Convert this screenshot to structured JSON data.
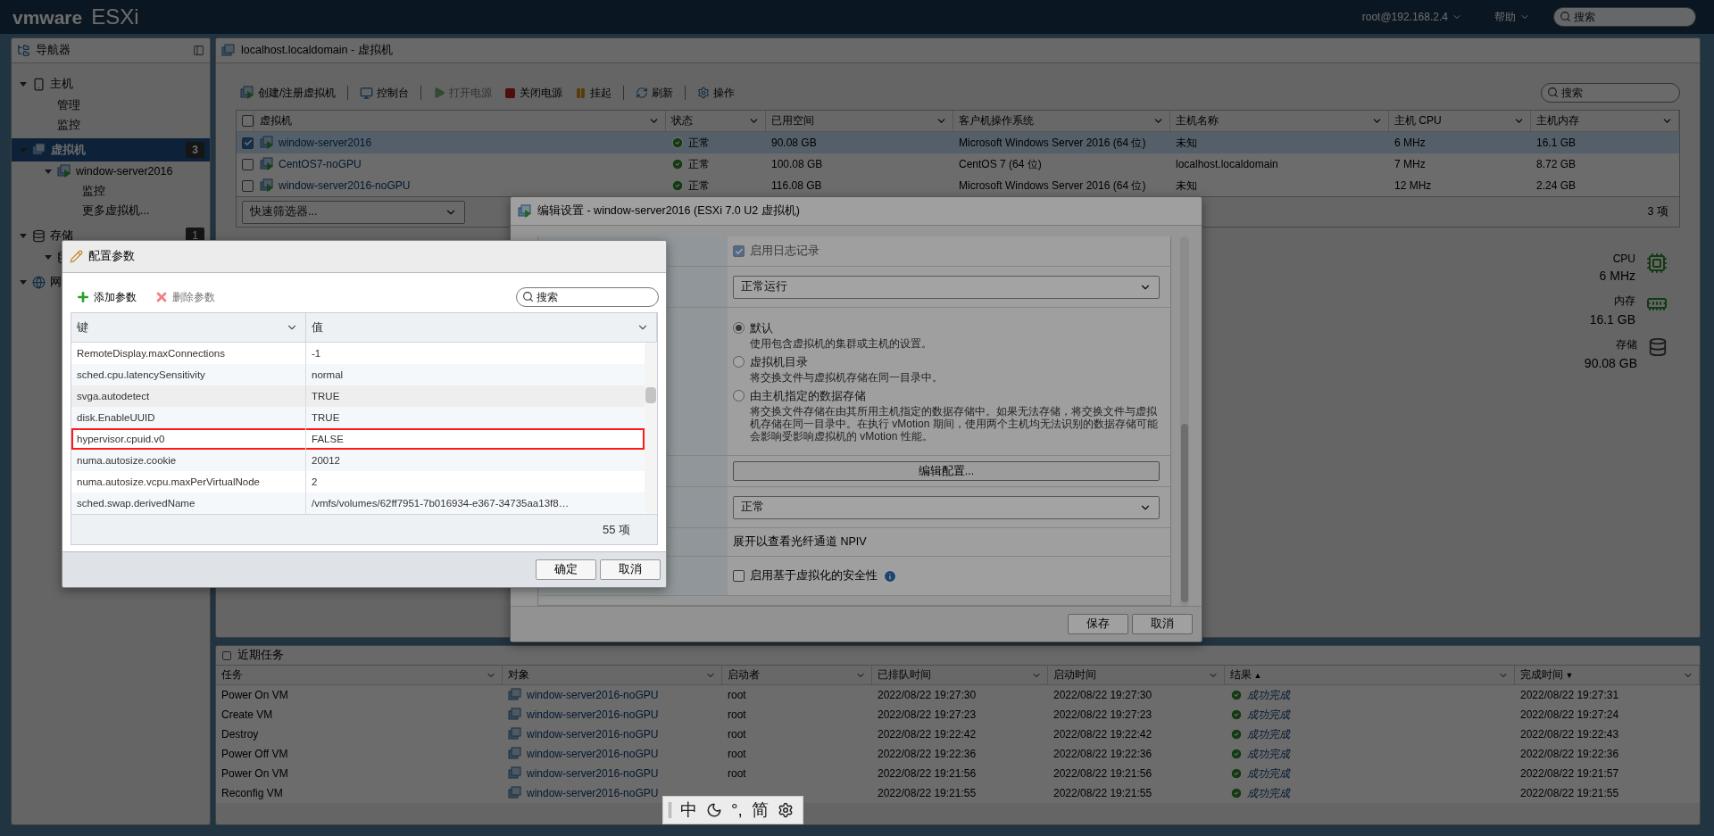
{
  "top_bar": {
    "logo_brand": "vmware",
    "logo_product": "ESXi",
    "user": "root@192.168.2.4",
    "help": "帮助",
    "search": {
      "placeholder": "搜索"
    }
  },
  "navigator": {
    "title": "导航器",
    "items": [
      {
        "label": "主机",
        "expanded": true,
        "selected": false,
        "children": [
          {
            "label": "管理",
            "selected": false
          },
          {
            "label": "监控",
            "selected": false
          }
        ]
      },
      {
        "label": "虚拟机",
        "badge": "3",
        "expanded": true,
        "selected": true,
        "children": [
          {
            "label": "window-server2016",
            "expanded": true,
            "selected": false,
            "children": [
              {
                "label": "监控",
                "selected": false
              },
              {
                "label": "更多虚拟机...",
                "selected": false
              }
            ]
          }
        ]
      },
      {
        "label": "存储",
        "badge": "1",
        "expanded": true,
        "selected": false,
        "children": [
          {
            "expanded": true,
            "selected": false
          }
        ]
      },
      {
        "label": "网",
        "expanded": true,
        "selected": false
      }
    ]
  },
  "vm_panel": {
    "title": "localhost.localdomain - 虚拟机",
    "toolbar": [
      {
        "label": "创建/注册虚拟机",
        "disabled": false,
        "separator_after": true
      },
      {
        "label": "控制台",
        "disabled": false,
        "separator_after": true
      },
      {
        "label": "打开电源",
        "disabled": true,
        "separator_after": false
      },
      {
        "label": "关闭电源",
        "disabled": false,
        "separator_after": false
      },
      {
        "label": "挂起",
        "disabled": false,
        "separator_after": true
      },
      {
        "label": "刷新",
        "disabled": false,
        "separator_after": true
      },
      {
        "label": "操作",
        "disabled": false,
        "separator_after": false
      }
    ],
    "search": {
      "placeholder": "搜索"
    },
    "table": {
      "all_checked": false,
      "columns": [
        {
          "label": "虚拟机",
          "kind": "vm"
        },
        {
          "label": "状态",
          "kind": "status"
        },
        {
          "label": "已用空间",
          "kind": "text"
        },
        {
          "label": "客户机操作系统",
          "kind": "text"
        },
        {
          "label": "主机名称",
          "kind": "text"
        },
        {
          "label": "主机 CPU",
          "kind": "text"
        },
        {
          "label": "主机内存",
          "kind": "text"
        }
      ],
      "rows": [
        {
          "checked": true,
          "selected": true,
          "cells": [
            "window-server2016",
            "正常",
            "90.08 GB",
            "Microsoft Windows Server 2016 (64 位)",
            "未知",
            "6 MHz",
            "16.1 GB"
          ]
        },
        {
          "checked": false,
          "selected": false,
          "cells": [
            "CentOS7-noGPU",
            "正常",
            "100.08 GB",
            "CentOS 7 (64 位)",
            "localhost.localdomain",
            "7 MHz",
            "8.72 GB"
          ]
        },
        {
          "checked": false,
          "selected": false,
          "cells": [
            "window-server2016-noGPU",
            "正常",
            "116.08 GB",
            "Microsoft Windows Server 2016 (64 位)",
            "未知",
            "12 MHz",
            "2.24 GB"
          ]
        }
      ]
    },
    "filter": {
      "placeholder": "快速筛选器..."
    },
    "count": "3 项",
    "summary": [
      {
        "label": "CPU",
        "value": "6 MHz"
      },
      {
        "label": "内存",
        "value": "16.1 GB"
      },
      {
        "label": "存储",
        "value": "90.08 GB"
      }
    ]
  },
  "recent_tasks": {
    "title": "近期任务",
    "columns": [
      {
        "label": "任务",
        "kind": "text"
      },
      {
        "label": "对象",
        "kind": "link"
      },
      {
        "label": "启动者",
        "kind": "text"
      },
      {
        "label": "已排队时间",
        "kind": "text"
      },
      {
        "label": "启动时间",
        "kind": "text"
      },
      {
        "label": "结果",
        "kind": "result",
        "sort_arrow": "▲"
      },
      {
        "label": "完成时间",
        "kind": "text",
        "sort_arrow": "▼"
      }
    ],
    "rows": [
      {
        "cells": [
          "Power On VM",
          "window-server2016-noGPU",
          "root",
          "2022/08/22 19:27:30",
          "2022/08/22 19:27:30",
          "成功完成",
          "2022/08/22 19:27:31"
        ]
      },
      {
        "cells": [
          "Create VM",
          "window-server2016-noGPU",
          "root",
          "2022/08/22 19:27:23",
          "2022/08/22 19:27:23",
          "成功完成",
          "2022/08/22 19:27:24"
        ]
      },
      {
        "cells": [
          "Destroy",
          "window-server2016-noGPU",
          "root",
          "2022/08/22 19:22:42",
          "2022/08/22 19:22:42",
          "成功完成",
          "2022/08/22 19:22:43"
        ]
      },
      {
        "cells": [
          "Power Off VM",
          "window-server2016-noGPU",
          "root",
          "2022/08/22 19:22:36",
          "2022/08/22 19:22:36",
          "成功完成",
          "2022/08/22 19:22:36"
        ]
      },
      {
        "cells": [
          "Power On VM",
          "window-server2016-noGPU",
          "root",
          "2022/08/22 19:21:56",
          "2022/08/22 19:21:56",
          "成功完成",
          "2022/08/22 19:21:57"
        ]
      },
      {
        "cells": [
          "Reconfig VM",
          "window-server2016-noGPU",
          null,
          "2022/08/22 19:21:55",
          "2022/08/22 19:21:55",
          "成功完成",
          "2022/08/22 19:21:55"
        ]
      }
    ]
  },
  "edit_dialog": {
    "title": "编辑设置 - window-server2016 (ESXi 7.0 U2 虚拟机)",
    "rows": [
      {
        "kind": "checkbox",
        "label": "启用日志记录",
        "checked": true,
        "disabled": true
      },
      {
        "kind": "select",
        "value": "正常运行"
      },
      {
        "kind": "radios",
        "options": [
          {
            "label": "默认",
            "description": "使用包含虚拟机的集群或主机的设置。",
            "selected": true
          },
          {
            "label": "虚拟机目录",
            "description": "将交换文件与虚拟机存储在同一目录中。",
            "selected": false
          },
          {
            "label": "由主机指定的数据存储",
            "description": "将交换文件存储在由其所用主机指定的数据存储中。如果无法存储，将交换文件与虚拟机存储在同一目录中。在执行 vMotion 期间，使用两个主机均无法识别的数据存储可能会影响受影响虚拟机的 vMotion 性能。",
            "selected": false
          }
        ]
      },
      {
        "kind": "button",
        "label": "编辑配置..."
      },
      {
        "kind": "select",
        "value": "正常"
      },
      {
        "kind": "text",
        "text": "展开以查看光纤通道 NPIV"
      },
      {
        "kind": "checkbox",
        "label": "启用基于虚拟化的安全性",
        "checked": false,
        "disabled": false,
        "info": true
      }
    ],
    "buttons": [
      "保存",
      "取消"
    ]
  },
  "config_dialog": {
    "title": "配置参数",
    "toolbar": [
      {
        "label": "添加参数",
        "disabled": false
      },
      {
        "label": "删除参数",
        "disabled": true
      }
    ],
    "search": {
      "placeholder": "搜索"
    },
    "columns": [
      "键",
      "值"
    ],
    "rows": [
      {
        "key": "RemoteDisplay.maxConnections",
        "value": "-1",
        "hovered": false,
        "highlighted": false
      },
      {
        "key": "sched.cpu.latencySensitivity",
        "value": "normal",
        "hovered": false,
        "highlighted": false
      },
      {
        "key": "svga.autodetect",
        "value": "TRUE",
        "hovered": true,
        "highlighted": false
      },
      {
        "key": "disk.EnableUUID",
        "value": "TRUE",
        "hovered": false,
        "highlighted": false
      },
      {
        "key": "hypervisor.cpuid.v0",
        "value": "FALSE",
        "hovered": false,
        "highlighted": true
      },
      {
        "key": "numa.autosize.cookie",
        "value": "20012",
        "hovered": false,
        "highlighted": false
      },
      {
        "key": "numa.autosize.vcpu.maxPerVirtualNode",
        "value": "2",
        "hovered": false,
        "highlighted": false
      },
      {
        "key": "sched.swap.derivedName",
        "value": "/vmfs/volumes/62ff7951-7b016934-e367-34735aa13f8…",
        "hovered": false,
        "highlighted": false
      }
    ],
    "count": "55 项",
    "buttons": [
      "确定",
      "取消"
    ]
  },
  "ime_bar": {
    "items": [
      {
        "kind": "text",
        "text": "中"
      },
      {
        "kind": "moon"
      },
      {
        "kind": "text",
        "text": "°,"
      },
      {
        "kind": "text",
        "text": "简"
      },
      {
        "kind": "gear"
      }
    ]
  }
}
